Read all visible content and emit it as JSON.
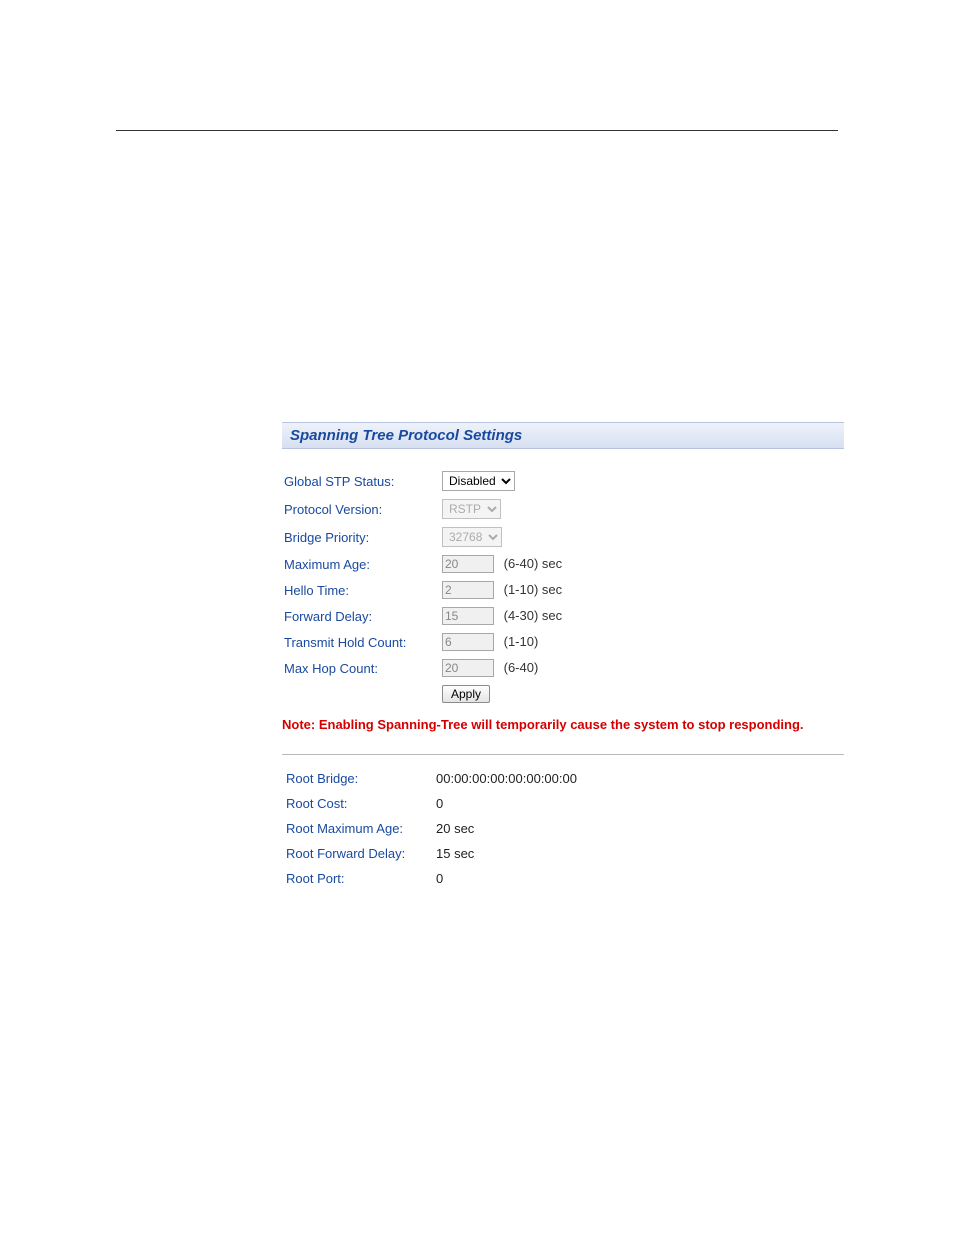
{
  "panel": {
    "title": "Spanning Tree Protocol Settings"
  },
  "fields": {
    "global_stp_status": {
      "label": "Global STP Status:",
      "value": "Disabled"
    },
    "protocol_version": {
      "label": "Protocol Version:",
      "value": "RSTP"
    },
    "bridge_priority": {
      "label": "Bridge Priority:",
      "value": "32768"
    },
    "maximum_age": {
      "label": "Maximum Age:",
      "value": "20",
      "hint": "(6-40) sec"
    },
    "hello_time": {
      "label": "Hello Time:",
      "value": "2",
      "hint": "(1-10) sec"
    },
    "forward_delay": {
      "label": "Forward Delay:",
      "value": "15",
      "hint": "(4-30) sec"
    },
    "transmit_hold_count": {
      "label": "Transmit Hold Count:",
      "value": "6",
      "hint": "(1-10)"
    },
    "max_hop_count": {
      "label": "Max Hop Count:",
      "value": "20",
      "hint": "(6-40)"
    }
  },
  "apply_label": "Apply",
  "note": "Note: Enabling Spanning-Tree will temporarily cause the system to stop responding.",
  "readonly": {
    "root_bridge": {
      "label": "Root Bridge:",
      "value": "00:00:00:00:00:00:00:00"
    },
    "root_cost": {
      "label": "Root Cost:",
      "value": "0"
    },
    "root_maximum_age": {
      "label": "Root Maximum Age:",
      "value": "20 sec"
    },
    "root_forward_delay": {
      "label": "Root Forward Delay:",
      "value": "15 sec"
    },
    "root_port": {
      "label": "Root Port:",
      "value": "0"
    }
  }
}
